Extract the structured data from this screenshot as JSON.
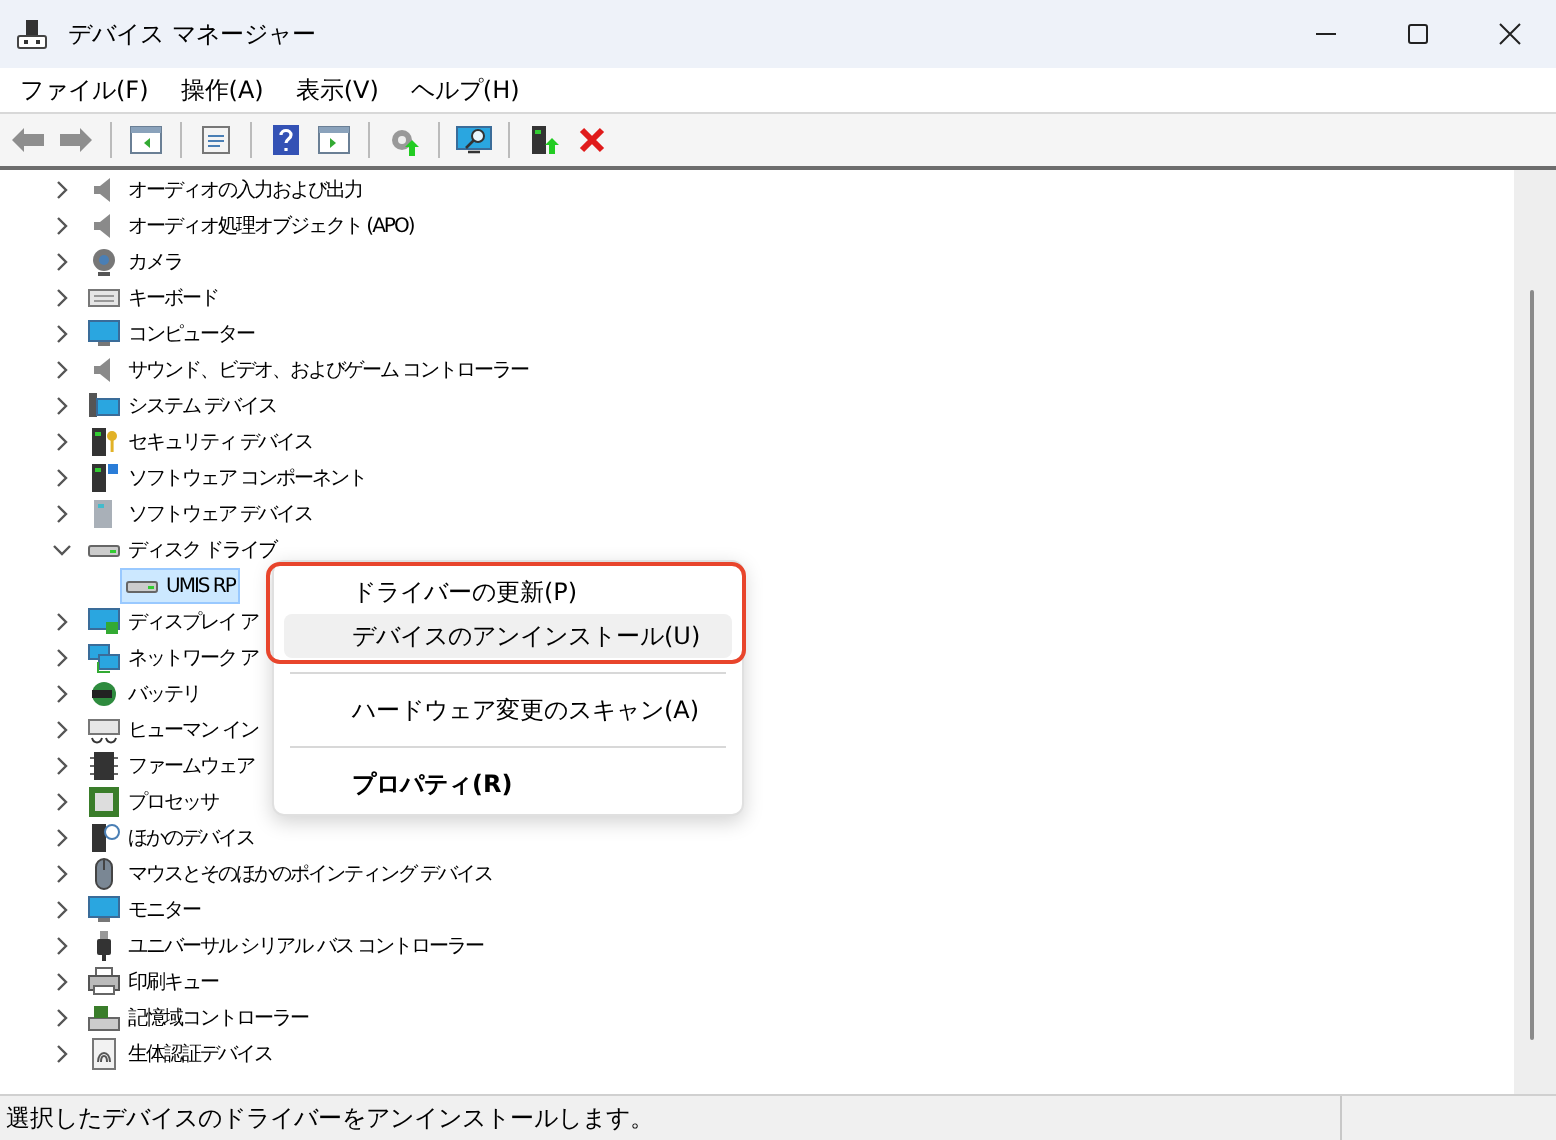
{
  "window": {
    "title": "デバイス マネージャー"
  },
  "menu_bar": [
    "ファイル(F)",
    "操作(A)",
    "表示(V)",
    "ヘルプ(H)"
  ],
  "tree": [
    {
      "label": "オーディオの入力および出力",
      "expanded": false,
      "selected": false
    },
    {
      "label": "オーディオ処理オブジェクト (APO)",
      "expanded": false,
      "selected": false
    },
    {
      "label": "カメラ",
      "expanded": false,
      "selected": false
    },
    {
      "label": "キーボード",
      "expanded": false,
      "selected": false
    },
    {
      "label": "コンピューター",
      "expanded": false,
      "selected": false
    },
    {
      "label": "サウンド、ビデオ、およびゲーム コントローラー",
      "expanded": false,
      "selected": false
    },
    {
      "label": "システム デバイス",
      "expanded": false,
      "selected": false
    },
    {
      "label": "セキュリティ デバイス",
      "expanded": false,
      "selected": false
    },
    {
      "label": "ソフトウェア コンポーネント",
      "expanded": false,
      "selected": false
    },
    {
      "label": "ソフトウェア デバイス",
      "expanded": false,
      "selected": false
    },
    {
      "label": "ディスク ドライブ",
      "expanded": true,
      "selected": false,
      "children": [
        {
          "label": "UMIS RP",
          "selected": true
        }
      ]
    },
    {
      "label": "ディスプレイ ア",
      "expanded": false,
      "selected": false
    },
    {
      "label": "ネットワーク ア",
      "expanded": false,
      "selected": false
    },
    {
      "label": "バッテリ",
      "expanded": false,
      "selected": false
    },
    {
      "label": "ヒューマン イン",
      "expanded": false,
      "selected": false
    },
    {
      "label": "ファームウェア",
      "expanded": false,
      "selected": false
    },
    {
      "label": "プロセッサ",
      "expanded": false,
      "selected": false
    },
    {
      "label": "ほかのデバイス",
      "expanded": false,
      "selected": false
    },
    {
      "label": "マウスとそのほかのポインティング デバイス",
      "expanded": false,
      "selected": false
    },
    {
      "label": "モニター",
      "expanded": false,
      "selected": false
    },
    {
      "label": "ユニバーサル シリアル バス コントローラー",
      "expanded": false,
      "selected": false
    },
    {
      "label": "印刷キュー",
      "expanded": false,
      "selected": false
    },
    {
      "label": "記憶域コントローラー",
      "expanded": false,
      "selected": false
    },
    {
      "label": "生体認証デバイス",
      "expanded": false,
      "selected": false
    }
  ],
  "context_menu": [
    {
      "kind": "item",
      "label": "ドライバーの更新(P)",
      "highlighted": false,
      "default": false
    },
    {
      "kind": "item",
      "label": "デバイスのアンインストール(U)",
      "highlighted": true,
      "default": false
    },
    {
      "kind": "separator"
    },
    {
      "kind": "item",
      "label": "ハードウェア変更のスキャン(A)",
      "highlighted": false,
      "default": false
    },
    {
      "kind": "separator"
    },
    {
      "kind": "item",
      "label": "プロパティ(R)",
      "highlighted": false,
      "default": true
    }
  ],
  "status_bar": {
    "text": "選択したデバイスのドライバーをアンインストールします。"
  }
}
